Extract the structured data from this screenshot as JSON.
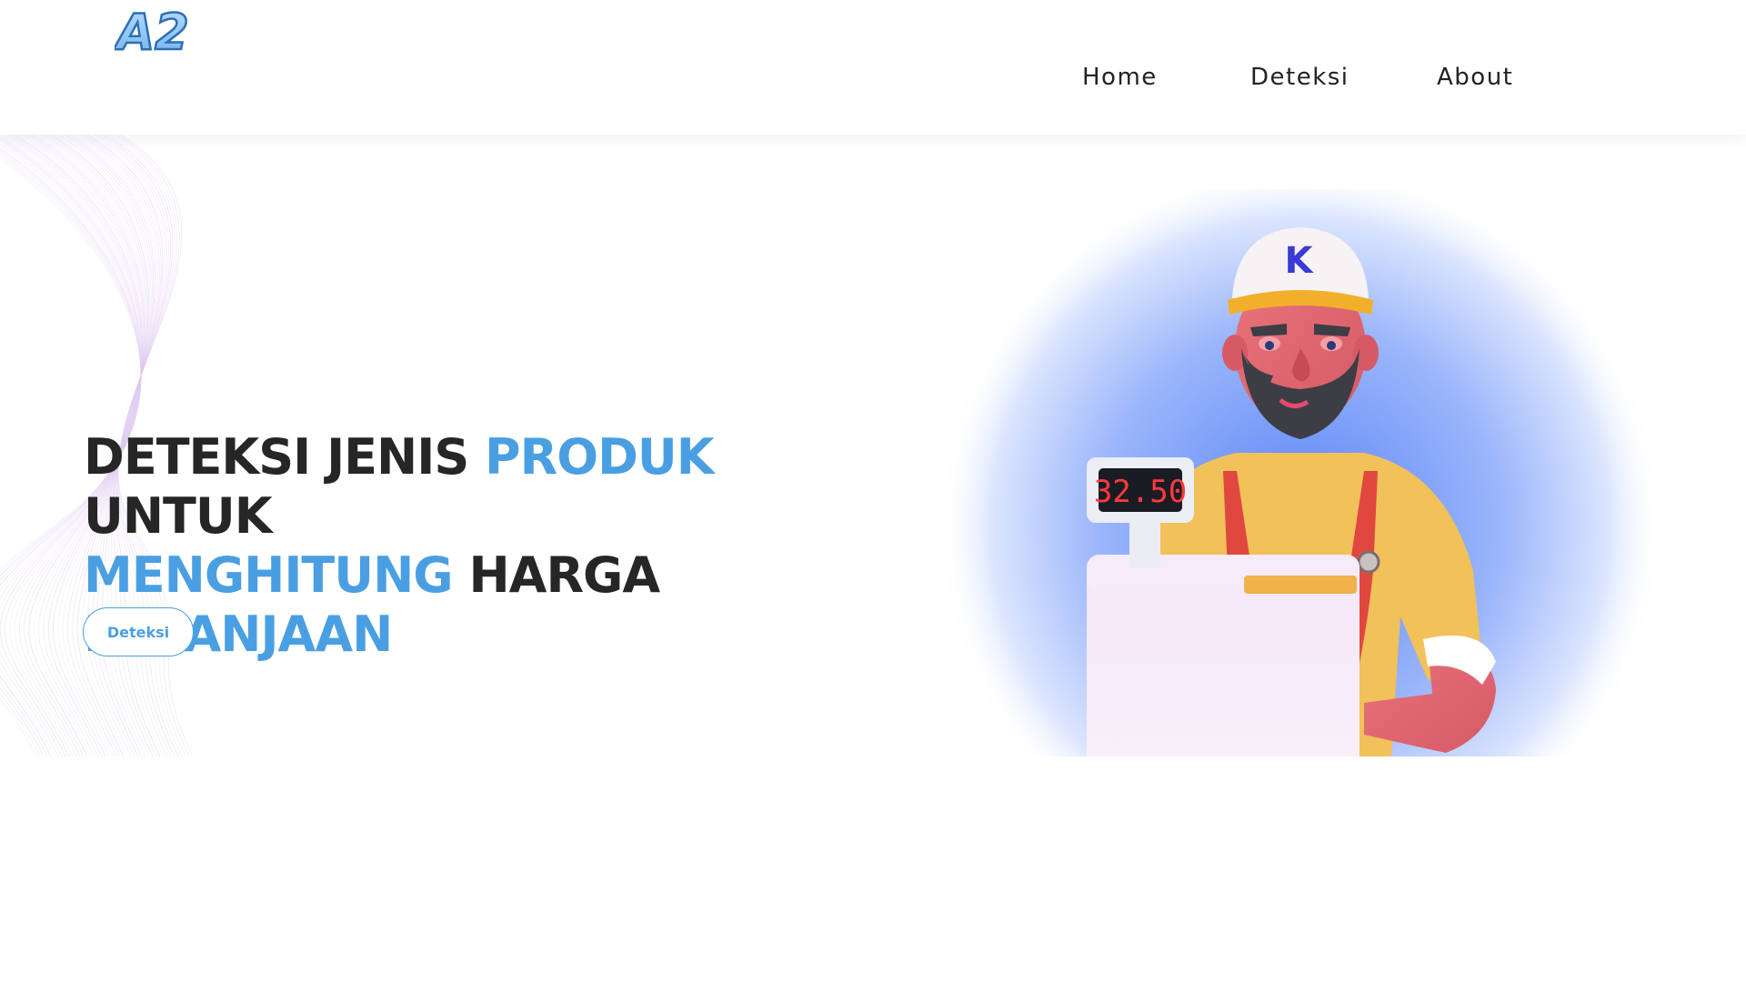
{
  "brand": {
    "logo_text": "A2"
  },
  "nav": {
    "items": [
      {
        "label": "Home"
      },
      {
        "label": "Deteksi"
      },
      {
        "label": "About"
      }
    ]
  },
  "hero": {
    "heading": {
      "w1": "DETEKSI JENIS",
      "w2": "PRODUK",
      "w3": "UNTUK",
      "w4": "MENGHITUNG",
      "w5": "HARGA",
      "w6": "BELANJAAN"
    },
    "cta_label": "Deteksi",
    "illustration": {
      "register_display": "32.50",
      "cap_logo": "K"
    }
  },
  "colors": {
    "accent": "#4a9fe3",
    "heading": "#262626",
    "nav_text": "#222222"
  }
}
